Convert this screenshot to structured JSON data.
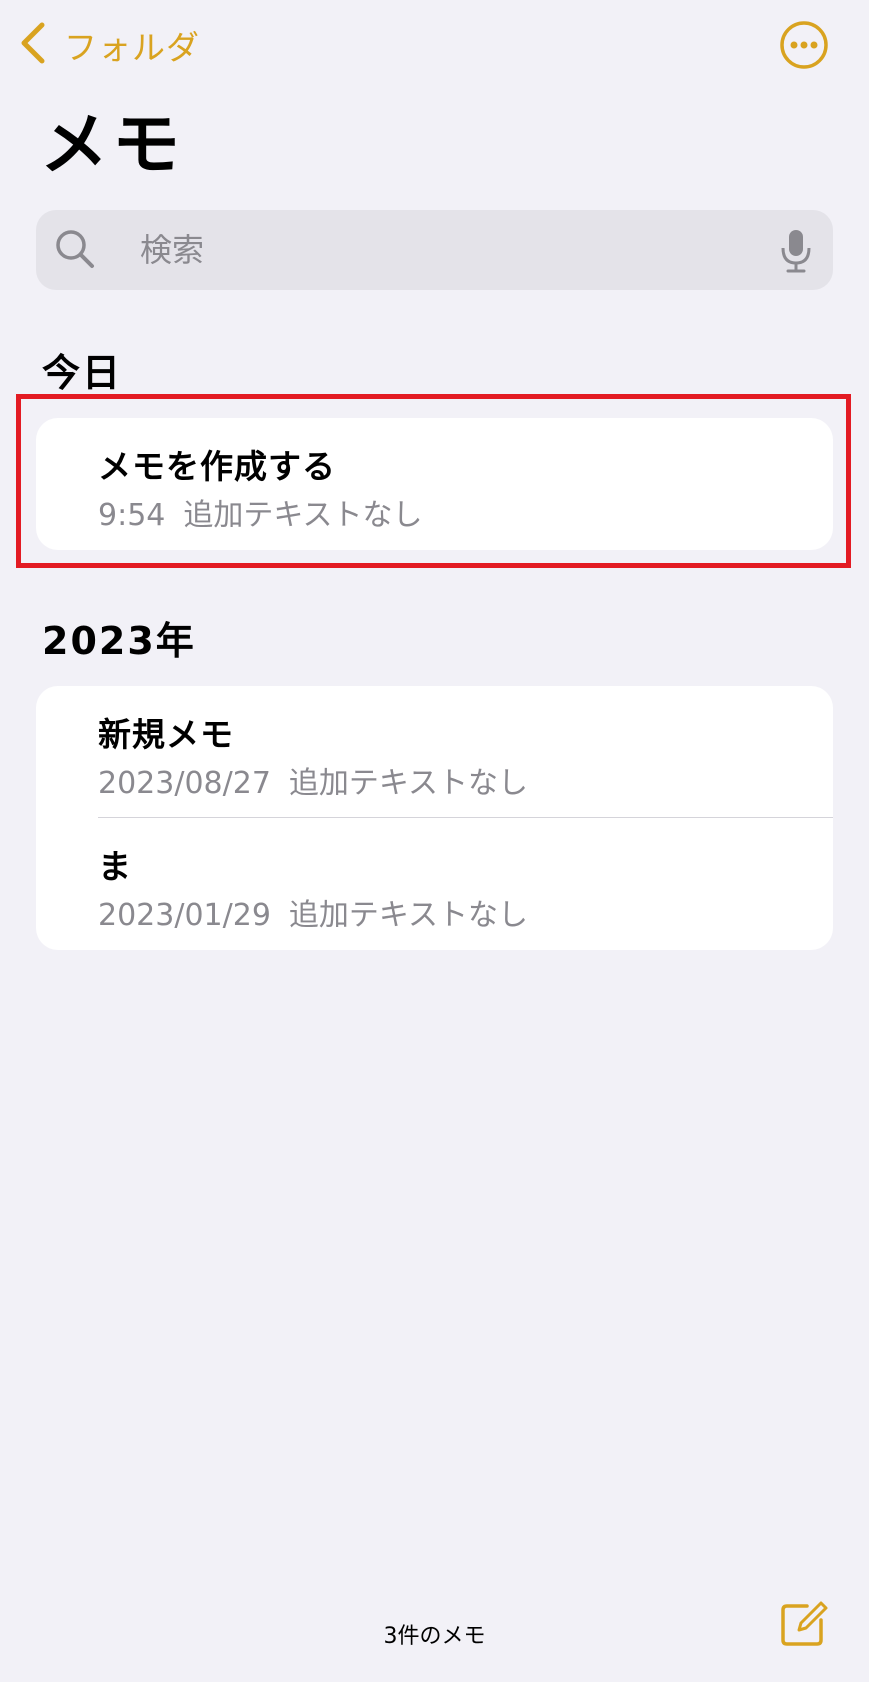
{
  "nav": {
    "back_label": "フォルダ",
    "accent_color": "#d9a320"
  },
  "page": {
    "title": "メモ"
  },
  "search": {
    "placeholder": "検索"
  },
  "sections": [
    {
      "header": "今日",
      "notes": [
        {
          "title": "メモを作成する",
          "date": "9:54",
          "preview": "追加テキストなし"
        }
      ]
    },
    {
      "header": "2023年",
      "notes": [
        {
          "title": "新規メモ",
          "date": "2023/08/27",
          "preview": "追加テキストなし"
        },
        {
          "title": "ま",
          "date": "2023/01/29",
          "preview": "追加テキストなし"
        }
      ]
    }
  ],
  "footer": {
    "count_label": "3件のメモ"
  },
  "icons": {
    "back": "chevron-left-icon",
    "more": "ellipsis-circle-icon",
    "search": "magnifying-glass-icon",
    "mic": "microphone-icon",
    "compose": "square-and-pencil-icon"
  },
  "highlight_color": "#e31b23"
}
